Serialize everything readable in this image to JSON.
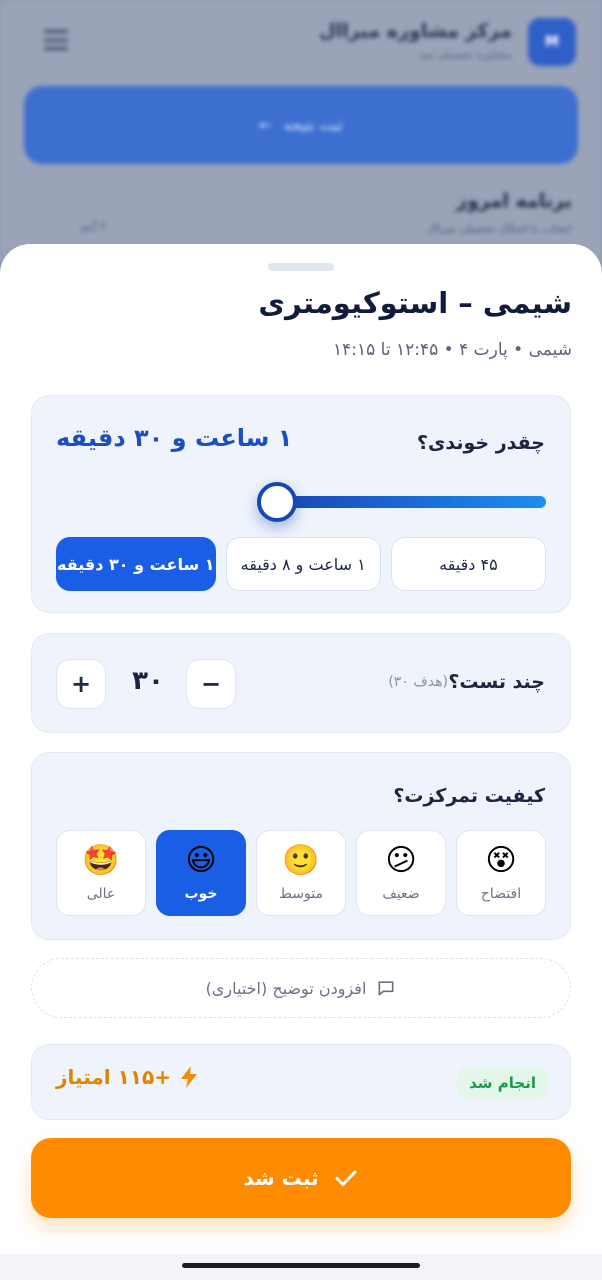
{
  "background": {
    "logo_text": "M",
    "app_title": "مرکز مشاوره میراال",
    "app_subtitle": "مشاوره تحصیلی تیم",
    "primary_button_label": "ثبت نتیجه",
    "section_title": "برنامه امروز",
    "section_subtitle": "انتخاب با اشکال تحصیلی میراال",
    "chip_label": "۳ آیتم"
  },
  "sheet": {
    "title": "شیمی – استوکیومتری",
    "subtitle": "شیمی • پارت ۴ • ۱۲:۴۵ تا ۱۴:۱۵"
  },
  "duration": {
    "question": "چقدر خوندی؟",
    "value": "۱ ساعت و ۳۰ دقیقه",
    "slider_fraction": 0.55,
    "presets": [
      {
        "label": "۴۵ دقیقه",
        "active": false
      },
      {
        "label": "۱ ساعت و ۸ دقیقه",
        "active": false
      },
      {
        "label": "۱ ساعت و ۳۰ دقیقه",
        "active": true
      }
    ]
  },
  "tests": {
    "question": "چند تست؟",
    "goal": "(هدف ۳۰)",
    "value": "۳۰",
    "minus_label": "−",
    "plus_label": "+"
  },
  "focus": {
    "question": "کیفیت تمرکزت؟",
    "options": [
      {
        "emoji": "😵",
        "label": "افتضاح",
        "active": false
      },
      {
        "emoji": "😕",
        "label": "ضعیف",
        "active": false
      },
      {
        "emoji": "🙂",
        "label": "متوسط",
        "active": false
      },
      {
        "emoji": "😃",
        "label": "خوب",
        "active": true
      },
      {
        "emoji": "🤩",
        "label": "عالی",
        "active": false
      }
    ]
  },
  "note": {
    "label": "افزودن توضیح (اختیاری)",
    "icon": "comment-icon"
  },
  "points": {
    "status": "انجام شد",
    "value": "+۱۱۵ امتیاز",
    "icon": "bolt-icon"
  },
  "submit": {
    "label": "ثبت شد",
    "icon": "check-icon"
  },
  "colors": {
    "accent": "#1a5ee6",
    "orange": "#ff8c00",
    "success": "#1c9a4b"
  }
}
